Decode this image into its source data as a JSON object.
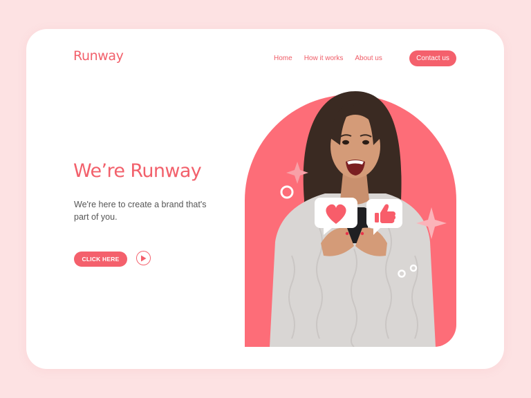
{
  "brand": {
    "logo_text": "Runway"
  },
  "nav": {
    "items": [
      {
        "label": "Home"
      },
      {
        "label": "How it works"
      },
      {
        "label": "About us"
      }
    ],
    "contact_label": "Contact us"
  },
  "hero": {
    "headline": "We’re Runway",
    "subtext": "We're here to create a brand that's part of you.",
    "cta_label": "CLICK HERE",
    "play_icon": "play-icon"
  },
  "colors": {
    "accent": "#f4606c",
    "page_bg": "#fde2e3",
    "card_bg": "#ffffff",
    "text": "#555555"
  },
  "icons": [
    "play-icon",
    "heart-icon",
    "thumbs-up-icon",
    "sparkle-icon",
    "ring-icon"
  ]
}
